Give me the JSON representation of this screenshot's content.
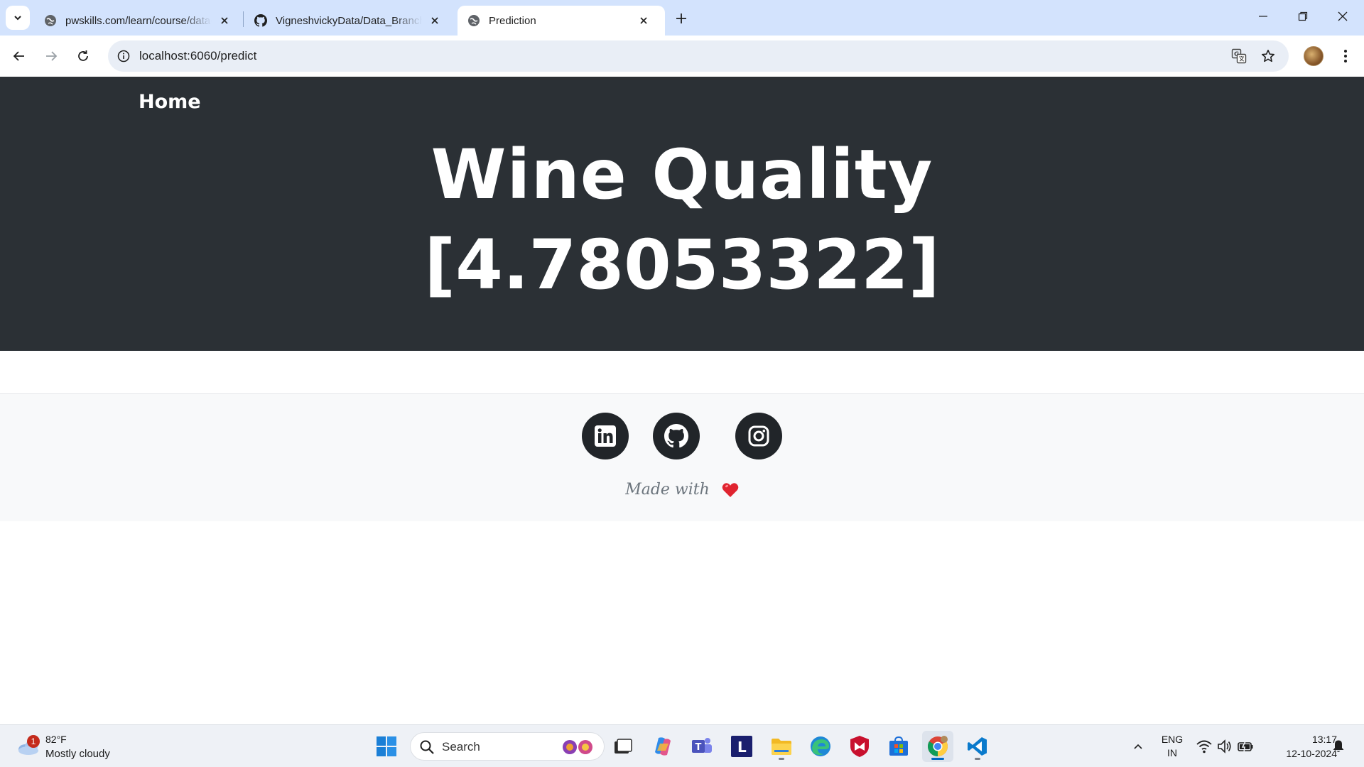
{
  "browser": {
    "tabs": [
      {
        "title": "pwskills.com/learn/course/data-science",
        "favicon": "globe-icon",
        "active": false
      },
      {
        "title": "VigneshvickyData/Data_Branch",
        "favicon": "github-icon",
        "active": false
      },
      {
        "title": "Prediction",
        "favicon": "globe-icon",
        "active": true
      }
    ],
    "url": "localhost:6060/predict"
  },
  "page": {
    "nav": {
      "home_label": "Home"
    },
    "hero": {
      "title": "Wine Quality",
      "prediction": "[4.78053322]"
    },
    "footer": {
      "social_icons": [
        "linkedin-icon",
        "github-icon",
        "instagram-icon"
      ],
      "made_with": "Made with",
      "heart_color": "#e0242f"
    },
    "colors": {
      "hero_bg": "#2b3035",
      "footer_bg": "#f8f9fa",
      "social_bg": "#212529"
    }
  },
  "taskbar": {
    "weather": {
      "badge": "1",
      "temp": "82°F",
      "condition": "Mostly cloudy"
    },
    "search_placeholder": "Search",
    "language": {
      "line1": "ENG",
      "line2": "IN"
    },
    "clock": {
      "time": "13:17",
      "date": "12-10-2024"
    }
  }
}
